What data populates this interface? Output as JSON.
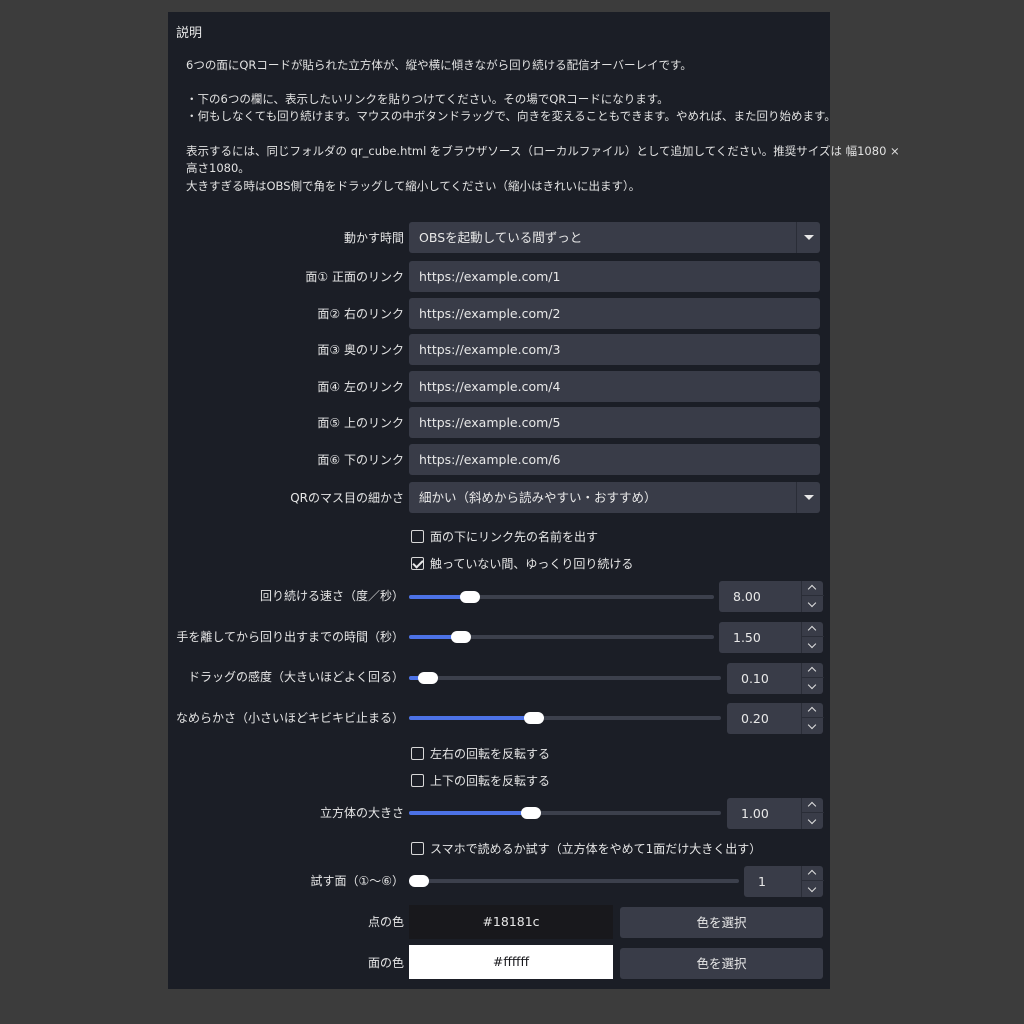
{
  "section_title": "説明",
  "description": [
    "6つの面にQRコードが貼られた立方体が、縦や横に傾きながら回り続ける配信オーバーレイです。",
    "・下の6つの欄に、表示したいリンクを貼りつけてください。その場でQRコードになります。",
    "・何もしなくても回り続けます。マウスの中ボタンドラッグで、向きを変えることもできます。やめれば、また回り始めます。",
    "表示するには、同じフォルダの qr_cube.html をブラウザソース（ローカルファイル）として追加してください。推奨サイズは 幅1080 ×",
    "高さ1080。",
    "大きすぎる時はOBS側で角をドラッグして縮小してください（縮小はきれいに出ます）。"
  ],
  "run_time": {
    "label": "動かす時間",
    "value": "OBSを起動している間ずっと"
  },
  "faces": [
    {
      "label": "面① 正面のリンク",
      "value": "https://example.com/1"
    },
    {
      "label": "面② 右のリンク",
      "value": "https://example.com/2"
    },
    {
      "label": "面③ 奥のリンク",
      "value": "https://example.com/3"
    },
    {
      "label": "面④ 左のリンク",
      "value": "https://example.com/4"
    },
    {
      "label": "面⑤ 上のリンク",
      "value": "https://example.com/5"
    },
    {
      "label": "面⑥ 下のリンク",
      "value": "https://example.com/6"
    }
  ],
  "qr_grid": {
    "label": "QRのマス目の細かさ",
    "value": "細かい（斜めから読みやすい・おすすめ）"
  },
  "checkboxes": [
    {
      "label": "面の下にリンク先の名前を出す",
      "checked": false
    },
    {
      "label": "触っていない間、ゆっくり回り続ける",
      "checked": true
    },
    {
      "label": "左右の回転を反転する",
      "checked": false
    },
    {
      "label": "上下の回転を反転する",
      "checked": false
    },
    {
      "label": "スマホで読めるか試す（立方体をやめて1面だけ大きく出す）",
      "checked": false
    }
  ],
  "sliders": [
    {
      "label": "回り続ける速さ（度／秒）",
      "value": "8.00",
      "level": 0.2
    },
    {
      "label": "手を離してから回り出すまでの時間（秒）",
      "value": "1.50",
      "level": 0.17
    },
    {
      "label": "ドラッグの感度（大きいほどよく回る）",
      "value": "0.10",
      "level": 0.06
    },
    {
      "label": "なめらかさ（小さいほどキビキビ止まる）",
      "value": "0.20",
      "level": 0.4
    },
    {
      "label": "立方体の大きさ",
      "value": "1.00",
      "level": 0.39
    },
    {
      "label": "試す面（①〜⑥）",
      "value": "1",
      "level": 0.03
    }
  ],
  "colors": [
    {
      "label": "点の色",
      "value": "#18181c",
      "swatch": "#18181c",
      "text_color": "#e8e8e8",
      "button": "色を選択"
    },
    {
      "label": "面の色",
      "value": "#ffffff",
      "swatch": "#ffffff",
      "text_color": "#18181c",
      "button": "色を選択"
    }
  ],
  "accent_color": "#4c72e6"
}
